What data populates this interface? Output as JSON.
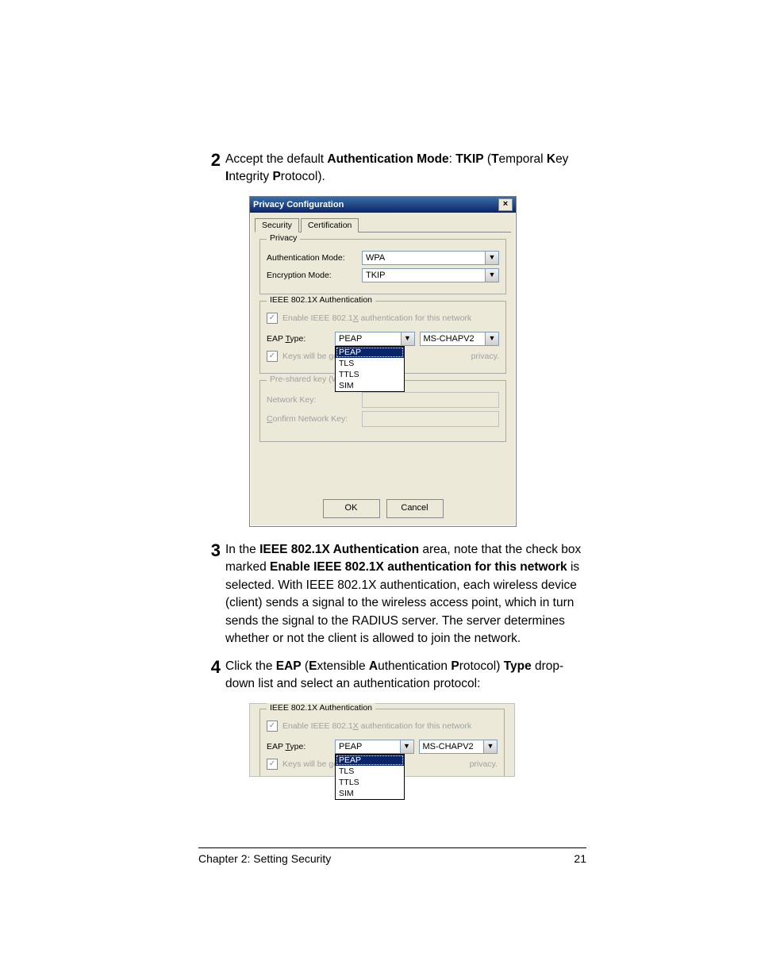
{
  "steps": {
    "s2": {
      "num": "2",
      "pre": "Accept the default ",
      "auth_mode_label": "Authentication Mode",
      "colon": ": ",
      "tkip": "TKIP",
      "open_paren": " (",
      "T": "T",
      "emporal": "emporal ",
      "K": "K",
      "ey": "ey ",
      "I": "I",
      "ntegrity": "ntegrity ",
      "P": "P",
      "rotocol": "rotocol)."
    },
    "s3": {
      "num": "3",
      "pre": "In the ",
      "ieee_area": "IEEE 802.1X Authentication",
      "mid1": " area, note that the check box marked ",
      "enable_label": "Enable IEEE 802.1X authentication for this network",
      "rest": " is selected. With IEEE 802.1X authentication, each wireless device (client) sends a signal to the wireless access point, which in turn sends the signal to the RADIUS server. The server determines whether or not the client is allowed to join the network."
    },
    "s4": {
      "num": "4",
      "pre": "Click the ",
      "eap": "EAP",
      "open_paren": " (",
      "E": "E",
      "xtensible": "xtensible ",
      "A": "A",
      "uthentication": "uthentication ",
      "P": "P",
      "rotocol": "rotocol) ",
      "type": "Type",
      "rest": " drop-down list and select an authentication protocol:"
    }
  },
  "dialog": {
    "title": "Privacy Configuration",
    "close": "×",
    "tabs": {
      "security": "Security",
      "certification": "Certification"
    },
    "privacy": {
      "legend": "Privacy",
      "auth_mode_label": "Authentication Mode:",
      "auth_mode_value": "WPA",
      "enc_mode_label": "Encryption Mode:",
      "enc_mode_value": "TKIP"
    },
    "ieee": {
      "legend": "IEEE 802.1X Authentication",
      "enable_label_pre": "Enable IEEE 802.1",
      "enable_label_u": "X",
      "enable_label_post": " authentication for this network",
      "eap_type_label_pre": "EAP ",
      "eap_type_label_u": "T",
      "eap_type_label_post": "ype:",
      "eap_type_value": "PEAP",
      "eap_method_value": "MS-CHAPV2",
      "eap_options": [
        "PEAP",
        "TLS",
        "TTLS",
        "SIM"
      ],
      "keys_label": "Keys will be generate",
      "privacy_word": "privacy."
    },
    "wpa": {
      "legend": "Pre-shared key (WPA)",
      "netkey_label": "Network Key:",
      "confirm_label_pre": "",
      "confirm_label_u": "C",
      "confirm_label_post": "onfirm Network Key:"
    },
    "buttons": {
      "ok": "OK",
      "cancel": "Cancel"
    }
  },
  "footer": {
    "chapter": "Chapter 2: Setting Security",
    "page": "21"
  }
}
